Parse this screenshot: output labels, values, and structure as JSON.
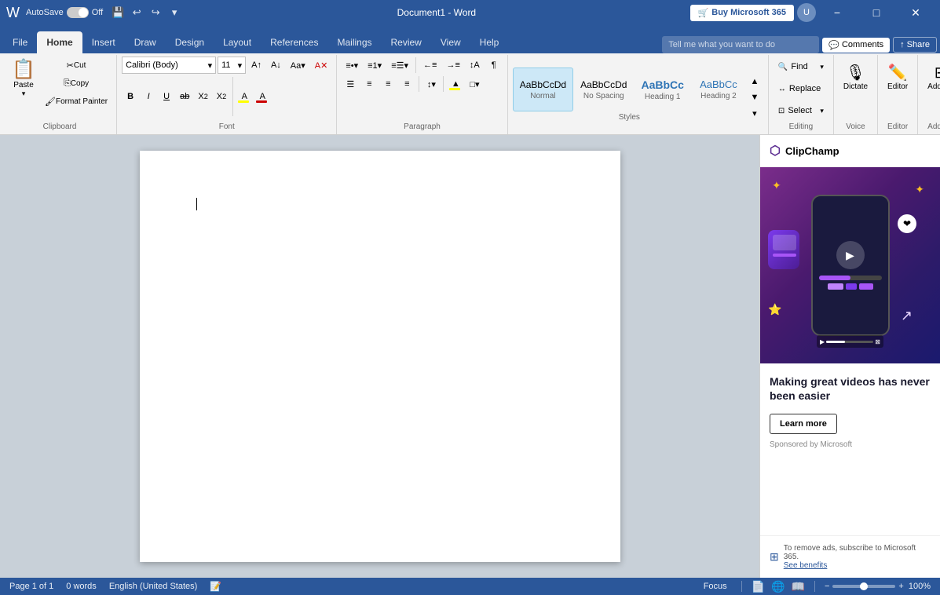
{
  "titlebar": {
    "app_name": "Word",
    "doc_title": "Document1 - Word",
    "autosave_label": "AutoSave",
    "autosave_state": "Off",
    "buy_btn_label": "Buy Microsoft 365",
    "minimize_icon": "−",
    "maximize_icon": "□",
    "close_icon": "✕"
  },
  "ribbon_tabs": {
    "tabs": [
      "File",
      "Home",
      "Insert",
      "Draw",
      "Design",
      "Layout",
      "References",
      "Mailings",
      "Review",
      "View",
      "Help"
    ],
    "active": "Home",
    "search_placeholder": "Tell me what you want to do",
    "comments_label": "Comments",
    "share_label": "Share"
  },
  "ribbon": {
    "clipboard": {
      "group_label": "Clipboard",
      "paste_label": "Paste",
      "cut_label": "Cut",
      "copy_label": "Copy",
      "format_painter_label": "Format Painter"
    },
    "font": {
      "group_label": "Font",
      "font_name": "Calibri (Body)",
      "font_size": "11",
      "bold": "B",
      "italic": "I",
      "underline": "U",
      "strikethrough": "ab",
      "subscript": "X₂",
      "superscript": "X²",
      "text_case": "Aa",
      "clear_format": "A",
      "highlight_color": "A",
      "font_color": "A"
    },
    "paragraph": {
      "group_label": "Paragraph",
      "bullets": "≡•",
      "numbering": "≡1",
      "multilevel": "≡☰",
      "decrease_indent": "←≡",
      "increase_indent": "→≡",
      "sort": "↕A",
      "show_marks": "¶",
      "align_left": "≡",
      "align_center": "≡",
      "align_right": "≡",
      "justify": "≡",
      "line_spacing": "↕",
      "shading": "▲",
      "borders": "□"
    },
    "styles": {
      "group_label": "Styles",
      "items": [
        {
          "label": "Normal",
          "sub": "Normal"
        },
        {
          "label": "No Spacing",
          "sub": ""
        },
        {
          "label": "Heading 1",
          "sub": ""
        },
        {
          "label": "Heading 2",
          "sub": ""
        }
      ],
      "more_icon": "▾"
    },
    "editing": {
      "group_label": "Editing",
      "find_label": "Find",
      "replace_label": "Replace",
      "select_label": "Select"
    },
    "voice": {
      "group_label": "Voice",
      "dictate_label": "Dictate"
    },
    "editor_group": {
      "group_label": "Editor",
      "editor_label": "Editor"
    },
    "addins": {
      "group_label": "Add-ins",
      "addins_label": "Add-ins"
    }
  },
  "document": {
    "content": "",
    "cursor": true
  },
  "side_panel": {
    "clipchamp_label": "ClipChamp",
    "ad_title": "Making great videos has never been easier",
    "learn_more_label": "Learn more",
    "sponsored_label": "Sponsored by Microsoft",
    "subscribe_text": "To remove ads, subscribe to Microsoft 365.",
    "see_benefits_label": "See benefits"
  },
  "statusbar": {
    "page_info": "Page 1 of 1",
    "words": "0 words",
    "language": "English (United States)",
    "focus_label": "Focus",
    "zoom_level": "100%",
    "minus_icon": "−",
    "plus_icon": "+"
  }
}
